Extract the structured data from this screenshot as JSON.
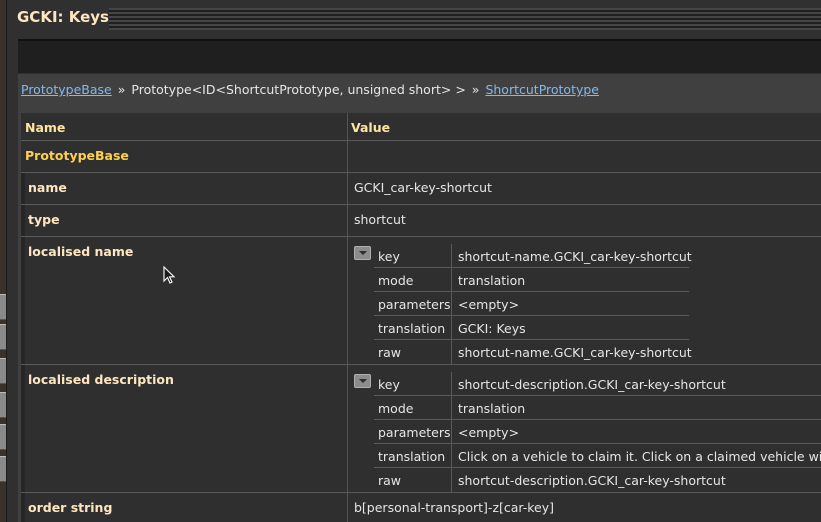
{
  "window": {
    "title": "GCKI: Keys"
  },
  "breadcrumb": {
    "link1": "PrototypeBase",
    "sep": "»",
    "middle": "Prototype<ID<ShortcutPrototype, unsigned short> >",
    "link2": "ShortcutPrototype"
  },
  "table": {
    "headers": {
      "name": "Name",
      "value": "Value"
    },
    "section": "PrototypeBase",
    "rows": {
      "name": {
        "label": "name",
        "value": "GCKI_car-key-shortcut"
      },
      "type": {
        "label": "type",
        "value": "shortcut"
      },
      "localised_name": {
        "label": "localised name",
        "key": {
          "k": "key",
          "v": "shortcut-name.GCKI_car-key-shortcut"
        },
        "mode": {
          "k": "mode",
          "v": "translation"
        },
        "parameters": {
          "k": "parameters",
          "v": "<empty>"
        },
        "translation": {
          "k": "translation",
          "v": "GCKI: Keys"
        },
        "raw": {
          "k": "raw",
          "v": "shortcut-name.GCKI_car-key-shortcut"
        }
      },
      "localised_description": {
        "label": "localised description",
        "key": {
          "k": "key",
          "v": "shortcut-description.GCKI_car-key-shortcut"
        },
        "mode": {
          "k": "mode",
          "v": "translation"
        },
        "parameters": {
          "k": "parameters",
          "v": "<empty>"
        },
        "translation": {
          "k": "translation",
          "v": "Click on a vehicle to claim it. Click on a claimed vehicle will lock/"
        },
        "raw": {
          "k": "raw",
          "v": "shortcut-description.GCKI_car-key-shortcut"
        }
      },
      "order": {
        "label": "order string",
        "value": "b[personal-transport]-z[car-key]"
      }
    }
  },
  "icons": {
    "toggle": "collapse-toggle-icon",
    "cursor": "mouse-cursor-icon"
  },
  "colors": {
    "link": "#84b8f0",
    "header": "#ffe6a0",
    "section": "#ffd050",
    "title": "#ffe6c0"
  }
}
